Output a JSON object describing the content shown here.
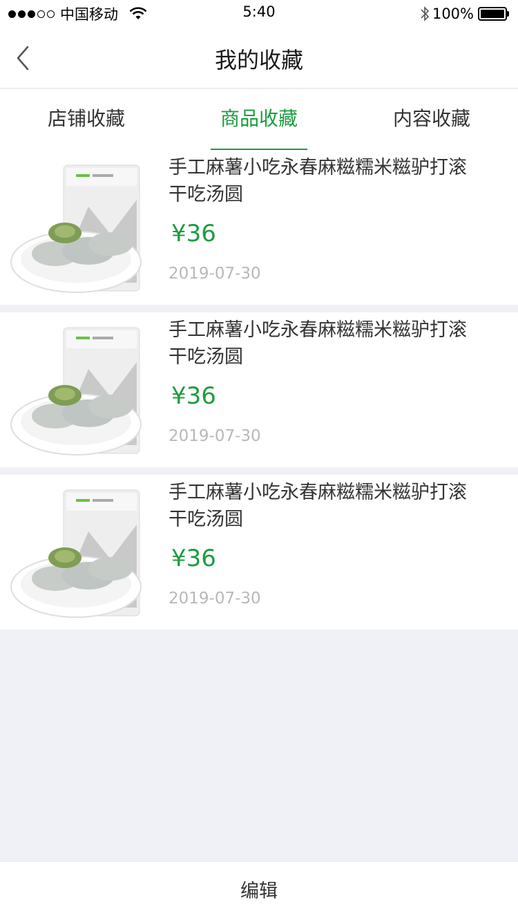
{
  "status_bar": {
    "carrier": "中国移动",
    "time": "5:40",
    "battery": "100%",
    "signal_bars": 3
  },
  "nav": {
    "title": "我的收藏"
  },
  "tabs": [
    {
      "label": "店铺收藏",
      "active": false
    },
    {
      "label": "商品收藏",
      "active": true
    },
    {
      "label": "内容收藏",
      "active": false
    }
  ],
  "items": [
    {
      "name": "手工麻薯小吃永春麻糍糯米糍驴打滚干吃汤圆",
      "price": "¥36",
      "date": "2019-07-30",
      "image": "mochi-product-image"
    },
    {
      "name": "手工麻薯小吃永春麻糍糯米糍驴打滚干吃汤圆",
      "price": "¥36",
      "date": "2019-07-30",
      "image": "mochi-product-image"
    },
    {
      "name": "手工麻薯小吃永春麻糍糯米糍驴打滚干吃汤圆",
      "price": "¥36",
      "date": "2019-07-30",
      "image": "mochi-product-image"
    }
  ],
  "bottom": {
    "edit_label": "编辑"
  },
  "colors": {
    "accent": "#1c9c3e",
    "background": "#f0f1f6",
    "date_gray": "#b8b8b8"
  }
}
